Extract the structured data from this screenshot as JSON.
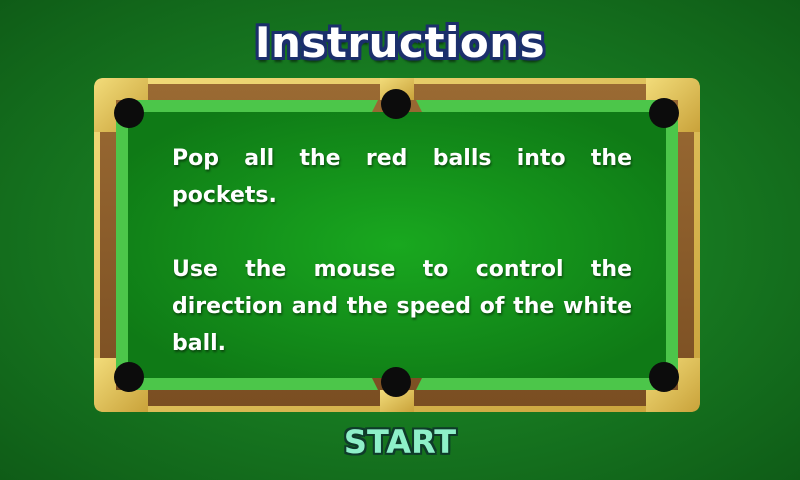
{
  "screen": {
    "title": "Instructions",
    "instructions": [
      "Pop all the red balls into the pockets.",
      "Use the mouse to control the direction and the speed of the white ball."
    ],
    "start_label": "START"
  },
  "colors": {
    "background": "#187d22",
    "felt": "#16a01f",
    "rail_wood": "#8a5a2b",
    "corner_gold": "#d9b84a",
    "title_outline": "#1b2f6b",
    "start_text": "#8ef0c9"
  }
}
